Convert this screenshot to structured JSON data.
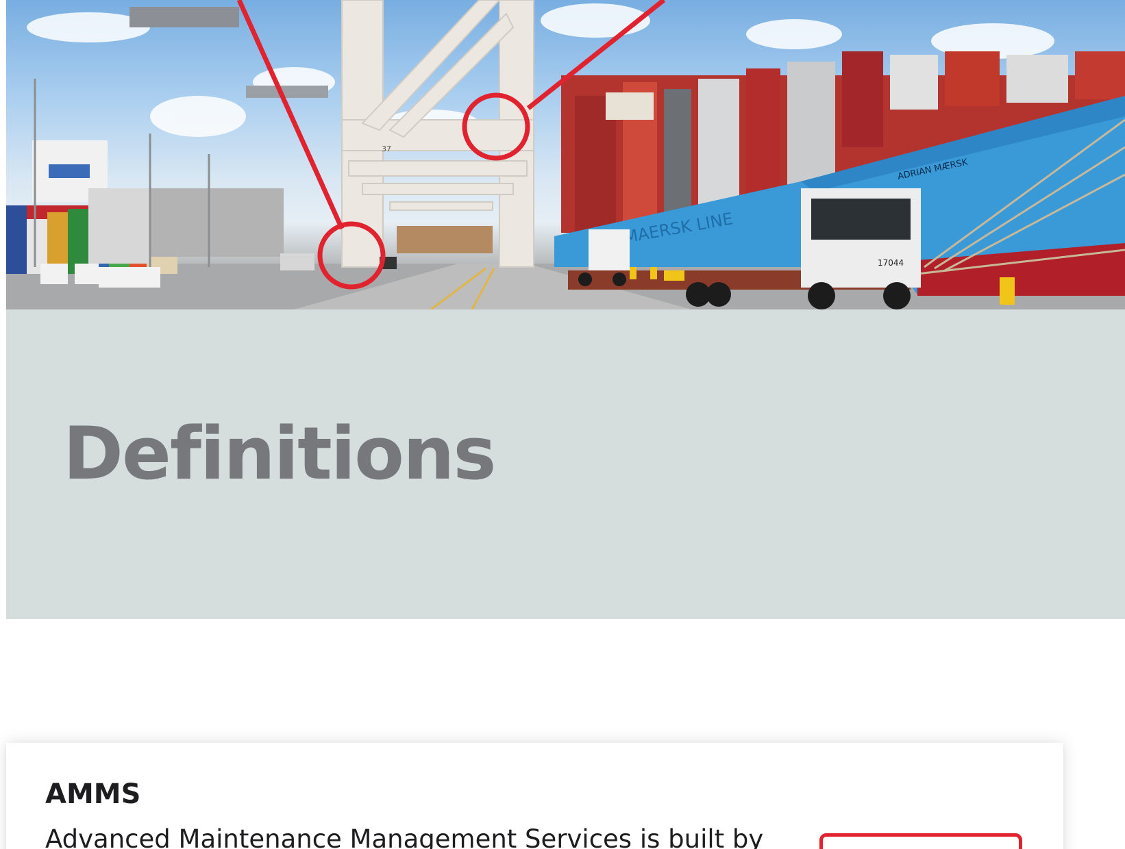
{
  "hero": {
    "image_description_label": "port-cranes-container-ship-photo",
    "crane_number": "37",
    "ship_name": "ADRIAN MÆRSK",
    "hull_text": "MAERSK LINE",
    "truck_number": "17044",
    "highlight_color": "#e0232e"
  },
  "banner": {
    "title": "Definitions",
    "background": "#d5dedd",
    "title_color": "#77787b"
  },
  "definitions": [
    {
      "term": "AMMS",
      "description": "Advanced Maintenance Management Services is built by"
    }
  ]
}
